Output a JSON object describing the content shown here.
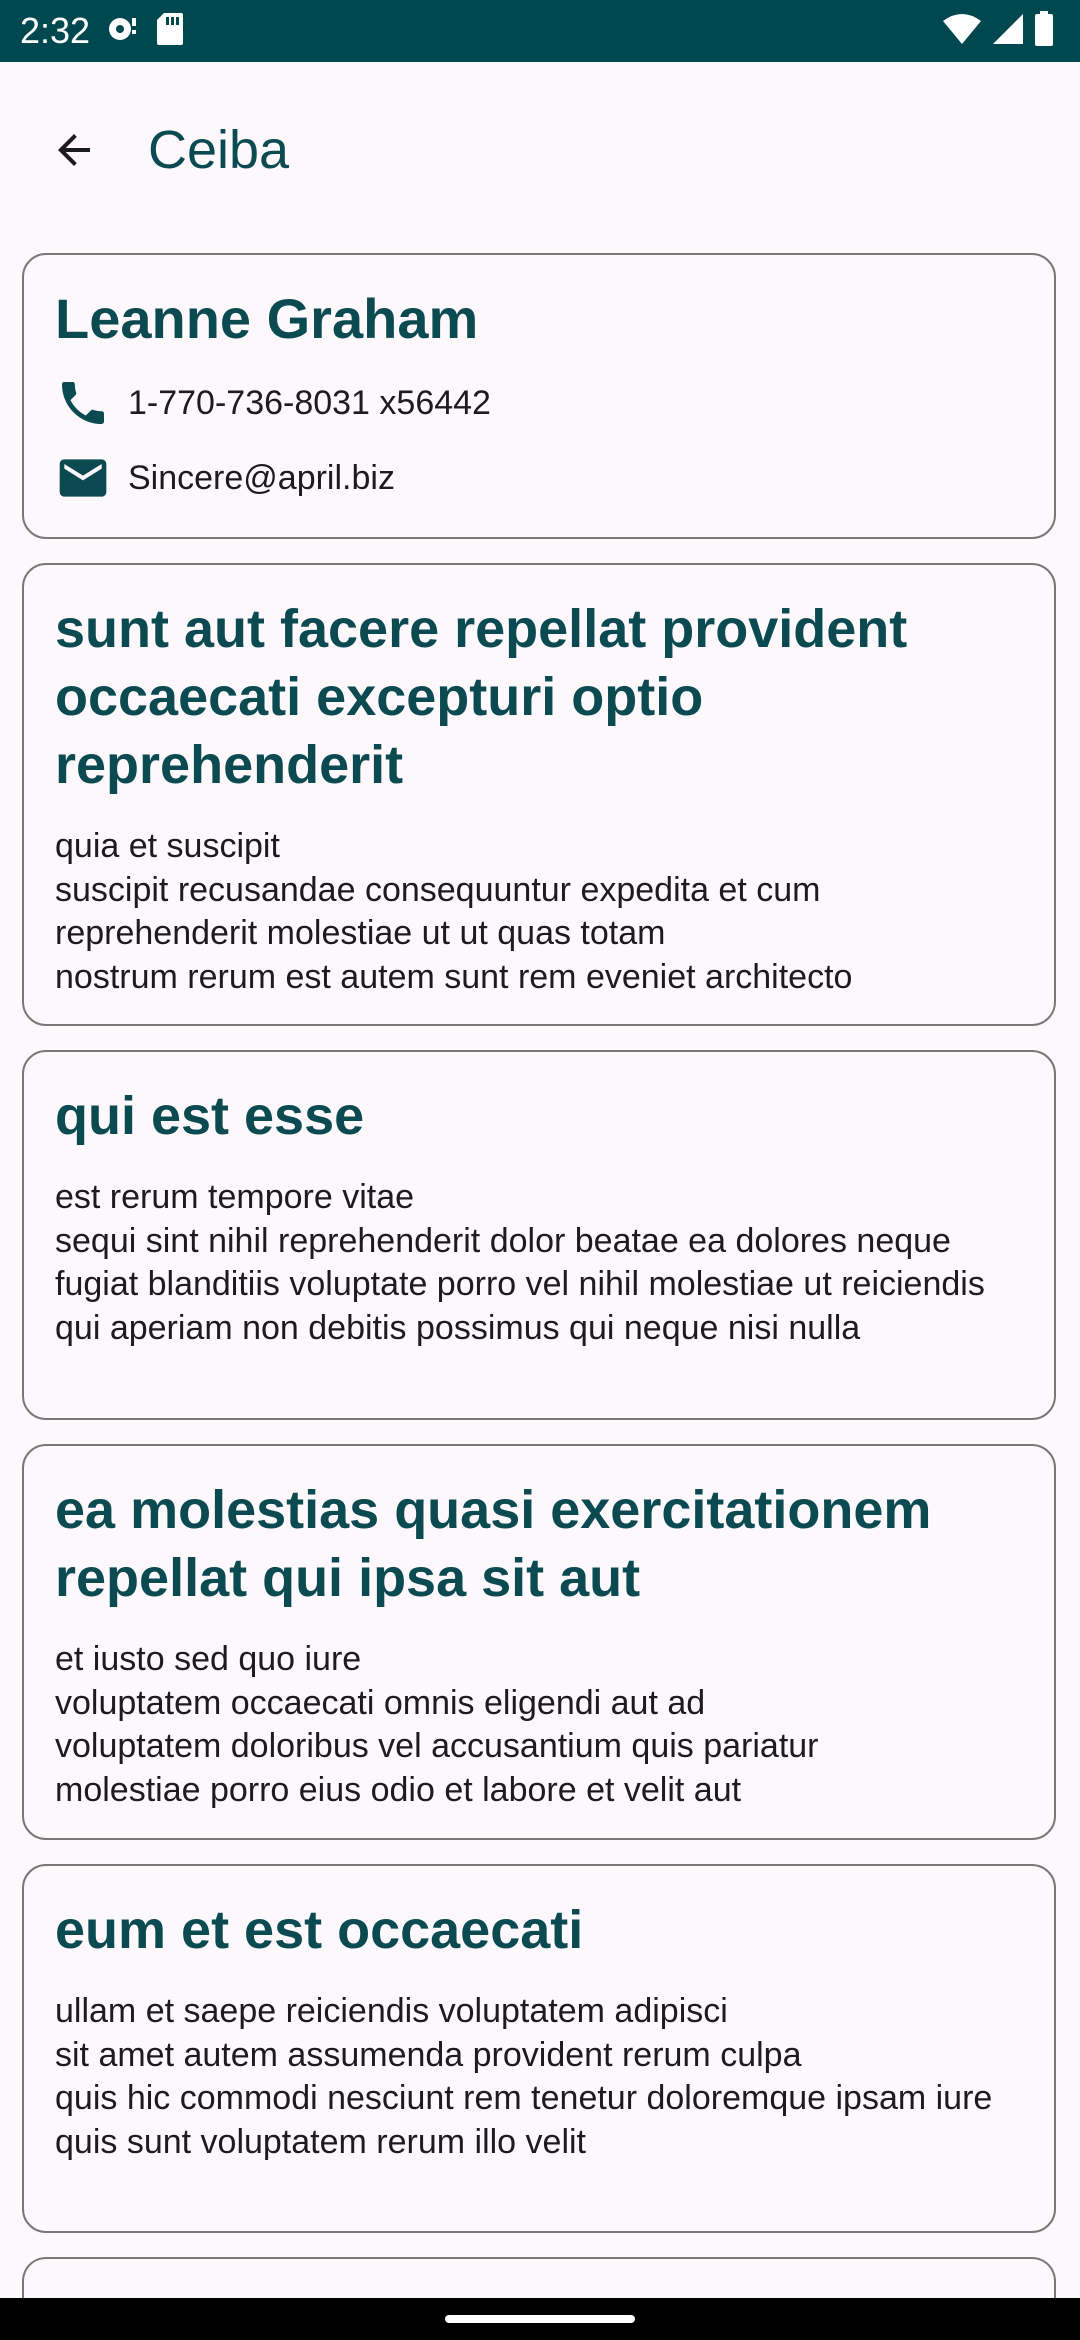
{
  "status_bar": {
    "time": "2:32",
    "background_color": "#004850",
    "icons_left": [
      "notification-icon",
      "sd-card-icon"
    ],
    "icons_right": [
      "wifi-icon",
      "signal-icon",
      "battery-icon"
    ]
  },
  "app_bar": {
    "back_icon": "arrow-back-icon",
    "title": "Ceiba"
  },
  "user": {
    "name": "Leanne Graham",
    "phone": "1-770-736-8031 x56442",
    "email": "Sincere@april.biz",
    "phone_icon": "phone-icon",
    "email_icon": "mail-icon"
  },
  "posts": [
    {
      "title": "sunt aut facere repellat provident occaecati excepturi optio reprehenderit",
      "body": "quia et suscipit\nsuscipit recusandae consequuntur expedita et cum\nreprehenderit molestiae ut ut quas totam\nnostrum rerum est autem sunt rem eveniet architecto"
    },
    {
      "title": "qui est esse",
      "body": "est rerum tempore vitae\nsequi sint nihil reprehenderit dolor beatae ea dolores neque\nfugiat blanditiis voluptate porro vel nihil molestiae ut reiciendis\nqui aperiam non debitis possimus qui neque nisi nulla"
    },
    {
      "title": "ea molestias quasi exercitationem repellat qui ipsa sit aut",
      "body": "et iusto sed quo iure\nvoluptatem occaecati omnis eligendi aut ad\nvoluptatem doloribus vel accusantium quis pariatur\nmolestiae porro eius odio et labore et velit aut"
    },
    {
      "title": "eum et est occaecati",
      "body": "ullam et saepe reiciendis voluptatem adipisci\nsit amet autem assumenda provident rerum culpa\nquis hic commodi nesciunt rem tenetur doloremque ipsam iure\nquis sunt voluptatem rerum illo velit"
    }
  ],
  "colors": {
    "accent": "#0c4a52",
    "surface": "#fdf8fc",
    "outline": "#7a7778",
    "on_surface": "#1c1b1f"
  }
}
